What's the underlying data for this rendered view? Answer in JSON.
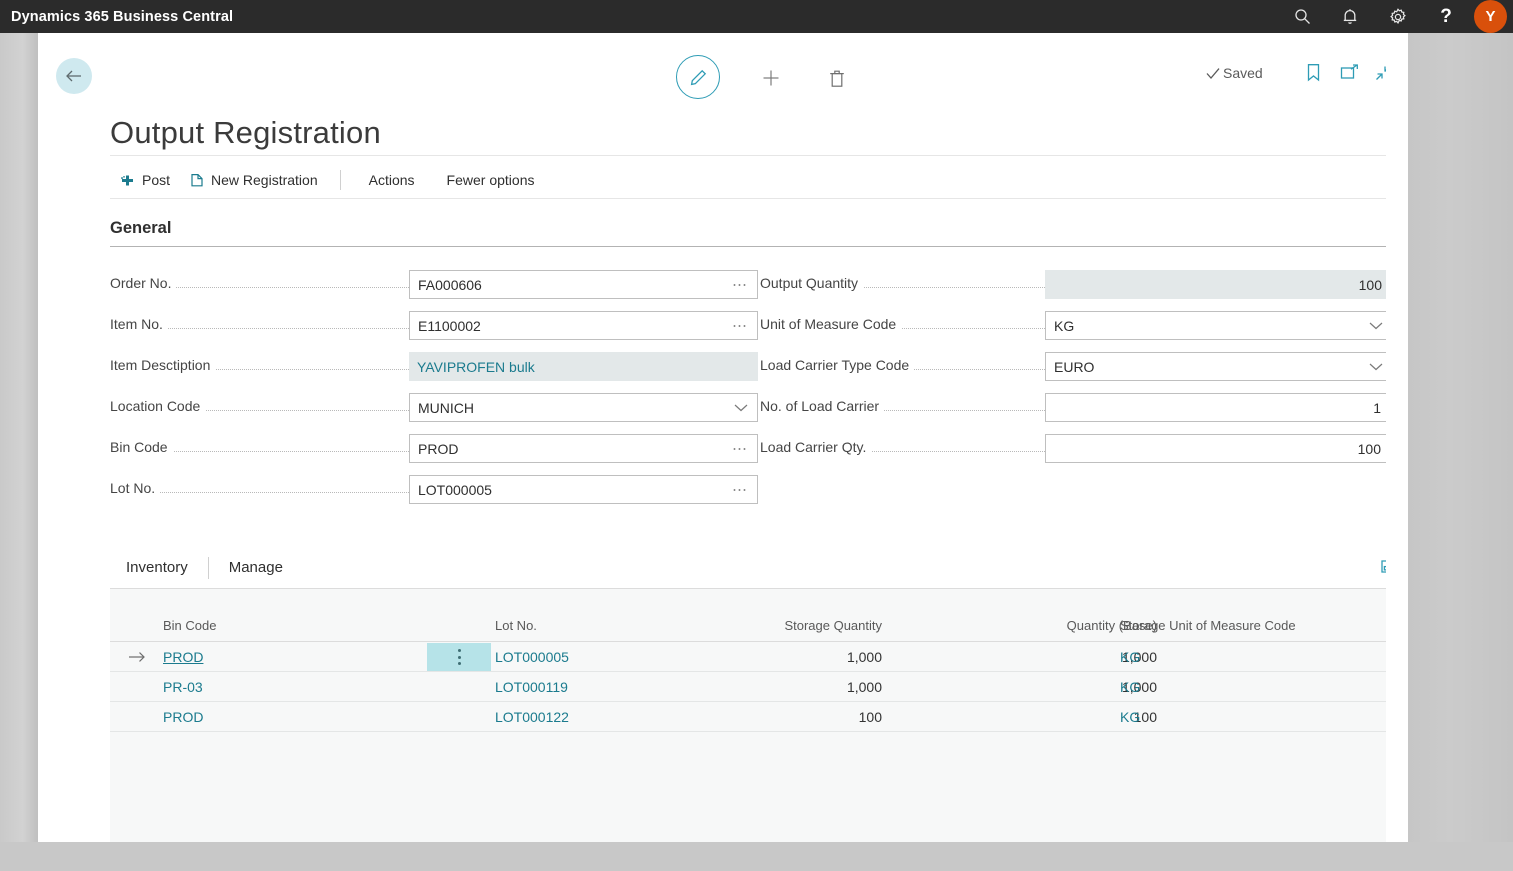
{
  "topbar": {
    "product_title": "Dynamics 365 Business Central",
    "search_icon": "search-icon",
    "notification_icon": "bell-icon",
    "settings_icon": "gear-icon",
    "help_label": "?",
    "avatar_initial": "Y",
    "avatar_color": "#d9500b"
  },
  "header": {
    "back_label": "Back",
    "edit_label": "Edit",
    "new_label": "New",
    "delete_label": "Delete",
    "saved_label": "Saved",
    "bookmark_label": "Bookmark",
    "popout_label": "Open in new window",
    "collapse_label": "Collapse",
    "page_title": "Output Registration"
  },
  "ribbon": {
    "items": [
      {
        "label": "Post",
        "icon": "post-icon"
      },
      {
        "label": "New Registration",
        "icon": "new-doc-icon"
      },
      {
        "label": "Actions",
        "icon": ""
      },
      {
        "label": "Fewer options",
        "icon": ""
      }
    ]
  },
  "general": {
    "section_title": "General",
    "left_fields": [
      {
        "label": "Order No.",
        "value": "FA000606",
        "control": "lookup"
      },
      {
        "label": "Item No.",
        "value": "E1100002",
        "control": "lookup"
      },
      {
        "label": "Item Desctiption",
        "value": "YAVIPROFEN bulk",
        "control": "readonly"
      },
      {
        "label": "Location Code",
        "value": "MUNICH",
        "control": "dropdown"
      },
      {
        "label": "Bin Code",
        "value": "PROD",
        "control": "lookup"
      },
      {
        "label": "Lot No.",
        "value": "LOT000005",
        "control": "lookup"
      }
    ],
    "right_fields": [
      {
        "label": "Output Quantity",
        "value": "100",
        "control": "readonly-numeric"
      },
      {
        "label": "Unit of Measure Code",
        "value": "KG",
        "control": "dropdown"
      },
      {
        "label": "Load Carrier Type Code",
        "value": "EURO",
        "control": "dropdown"
      },
      {
        "label": "No. of Load Carrier",
        "value": "1",
        "control": "numeric"
      },
      {
        "label": "Load Carrier Qty.",
        "value": "100",
        "control": "numeric"
      }
    ]
  },
  "subpage": {
    "tabs": [
      {
        "label": "Inventory"
      },
      {
        "label": "Manage"
      }
    ],
    "expand_icon": "open-in-excel-icon",
    "columns": [
      "Bin Code",
      "Lot No.",
      "Storage Quantity",
      "Quantity (Base)",
      "Storage Unit of Measure Code"
    ],
    "rows": [
      {
        "selected": true,
        "bin_code": "PROD",
        "lot_no": "LOT000005",
        "storage_quantity": "1,000",
        "quantity_base": "1,000",
        "storage_uom": "KG"
      },
      {
        "selected": false,
        "bin_code": "PR-03",
        "lot_no": "LOT000119",
        "storage_quantity": "1,000",
        "quantity_base": "1,000",
        "storage_uom": "KG"
      },
      {
        "selected": false,
        "bin_code": "PROD",
        "lot_no": "LOT000122",
        "storage_quantity": "100",
        "quantity_base": "100",
        "storage_uom": "KG"
      }
    ]
  },
  "colors": {
    "accent_teal": "#1b7b8e",
    "selection_cyan": "#b6e3e8",
    "topbar_dark": "#2b2b2b"
  }
}
